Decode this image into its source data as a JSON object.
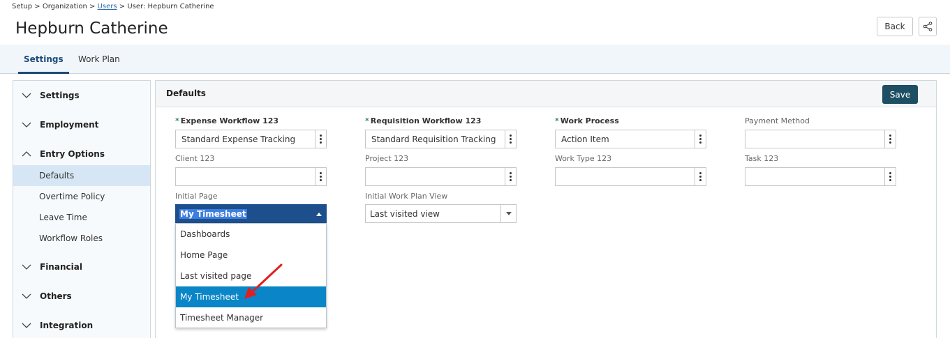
{
  "breadcrumb": {
    "setup": "Setup",
    "organization": "Organization",
    "users": "Users",
    "user": "User: Hepburn Catherine",
    "sep": ">"
  },
  "page_title": "Hepburn Catherine",
  "header_actions": {
    "back": "Back",
    "share_icon": "share-icon"
  },
  "tabs": [
    {
      "label": "Settings",
      "active": true
    },
    {
      "label": "Work Plan",
      "active": false
    }
  ],
  "sidebar": {
    "groups": {
      "settings": {
        "label": "Settings",
        "expanded": false
      },
      "employment": {
        "label": "Employment",
        "expanded": false
      },
      "entry_options": {
        "label": "Entry Options",
        "expanded": true
      },
      "financial": {
        "label": "Financial",
        "expanded": false
      },
      "others": {
        "label": "Others",
        "expanded": false
      },
      "integration": {
        "label": "Integration",
        "expanded": false
      }
    },
    "entry_items": [
      "Defaults",
      "Overtime Policy",
      "Leave Time",
      "Workflow Roles"
    ],
    "selected": "Defaults"
  },
  "panel": {
    "title": "Defaults",
    "save": "Save"
  },
  "fields": {
    "expense_workflow": {
      "label": "Expense Workflow 123",
      "required": true,
      "value": "Standard Expense Tracking"
    },
    "requisition_workflow": {
      "label": "Requisition Workflow 123",
      "required": true,
      "value": "Standard Requisition Tracking"
    },
    "work_process": {
      "label": "Work Process",
      "required": true,
      "value": "Action Item"
    },
    "payment_method": {
      "label": "Payment Method",
      "required": false,
      "value": ""
    },
    "client": {
      "label": "Client 123",
      "required": false,
      "value": ""
    },
    "project": {
      "label": "Project 123",
      "required": false,
      "value": ""
    },
    "work_type": {
      "label": "Work Type 123",
      "required": false,
      "value": ""
    },
    "task": {
      "label": "Task 123",
      "required": false,
      "value": ""
    },
    "initial_page": {
      "label": "Initial Page",
      "value": "My Timesheet",
      "options": [
        "Dashboards",
        "Home Page",
        "Last visited page",
        "My Timesheet",
        "Timesheet Manager"
      ],
      "highlighted": "My Timesheet"
    },
    "initial_work_plan_view": {
      "label": "Initial Work Plan View",
      "value": "Last visited view"
    }
  },
  "colors": {
    "accent": "#1b4a78",
    "save_bg": "#1d4e63",
    "highlight": "#0a85c7",
    "required_star": "#2e8b57",
    "arrow": "#e02020"
  }
}
